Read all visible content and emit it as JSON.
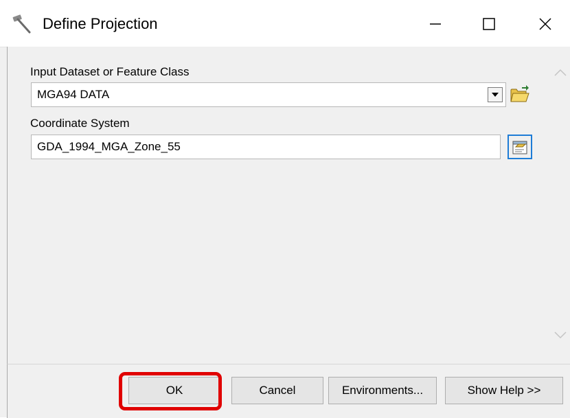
{
  "window": {
    "title": "Define Projection",
    "icons": {
      "app": "hammer-icon",
      "minimize": "minimize-icon",
      "maximize": "maximize-icon",
      "close": "close-icon"
    }
  },
  "form": {
    "input_dataset": {
      "label": "Input Dataset or Feature Class",
      "value": "MGA94 DATA",
      "browse_icon": "open-folder-icon"
    },
    "coordinate_system": {
      "label": "Coordinate System",
      "value": "GDA_1994_MGA_Zone_55",
      "properties_icon": "spatial-reference-properties-icon"
    }
  },
  "buttons": {
    "ok": "OK",
    "cancel": "Cancel",
    "environments": "Environments...",
    "show_help": "Show Help >>"
  },
  "colors": {
    "highlight": "#e00000",
    "focus": "#1d7cd6"
  }
}
